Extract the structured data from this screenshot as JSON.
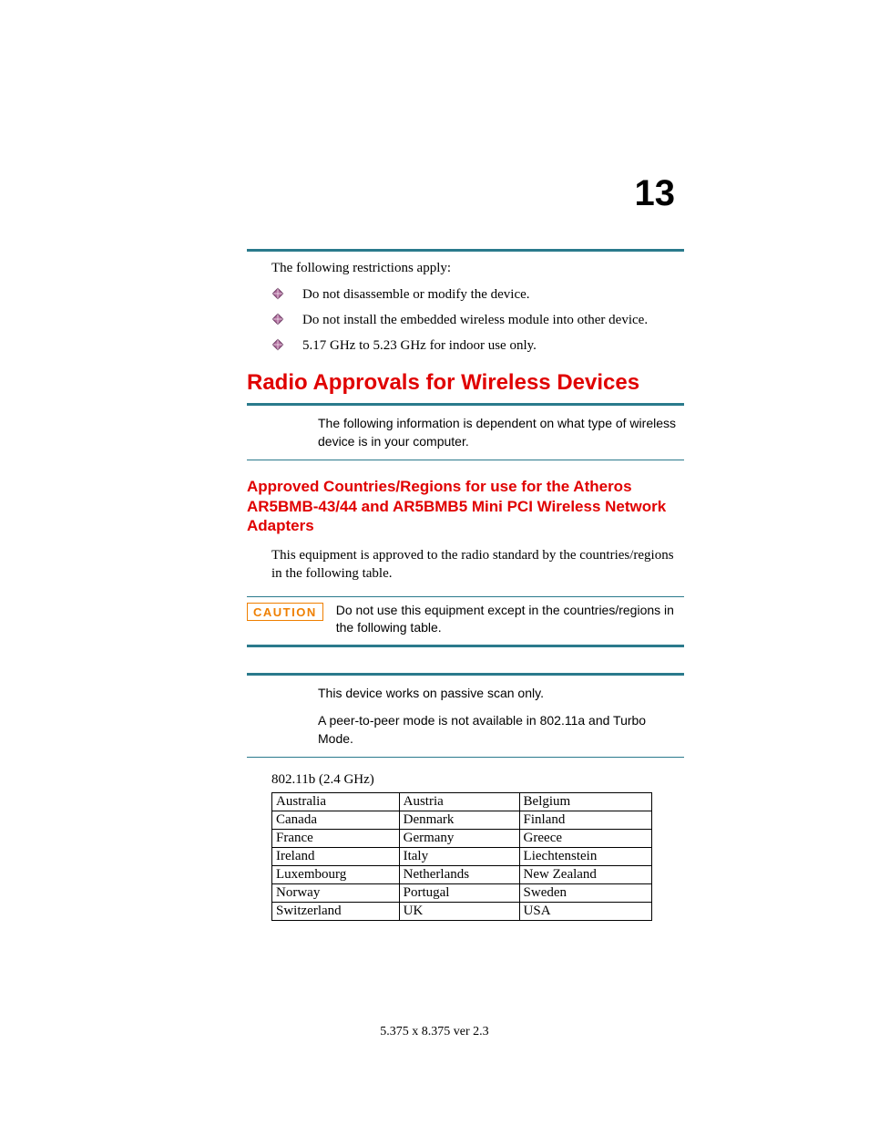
{
  "page_number": "13",
  "intro": "The following restrictions apply:",
  "bullets": [
    "Do not disassemble or modify the device.",
    "Do not install the embedded wireless module into other device.",
    "5.17 GHz to 5.23 GHz for indoor use only."
  ],
  "section_heading": "Radio Approvals for Wireless Devices",
  "section_note": "The following information is dependent on what type of wireless device is in your computer.",
  "subsection_heading": "Approved Countries/Regions for use for the Atheros AR5BMB-43/44 and AR5BMB5 Mini PCI Wireless Network Adapters",
  "approval_text": "This equipment is approved to the radio standard by the countries/regions in the following table.",
  "caution_label": "CAUTION",
  "caution_text": "Do not use this equipment except in the countries/regions in the following table.",
  "passive_scan_note": "This device works on passive scan only.",
  "peer_note": "A peer-to-peer mode is not available in 802.11a and Turbo Mode.",
  "table_title": "802.11b (2.4 GHz)",
  "countries": [
    [
      "Australia",
      "Austria",
      "Belgium"
    ],
    [
      "Canada",
      "Denmark",
      "Finland"
    ],
    [
      "France",
      "Germany",
      "Greece"
    ],
    [
      "Ireland",
      "Italy",
      "Liechtenstein"
    ],
    [
      "Luxembourg",
      "Netherlands",
      "New Zealand"
    ],
    [
      "Norway",
      "Portugal",
      "Sweden"
    ],
    [
      "Switzerland",
      "UK",
      "USA"
    ]
  ],
  "footer": "5.375 x 8.375 ver 2.3"
}
